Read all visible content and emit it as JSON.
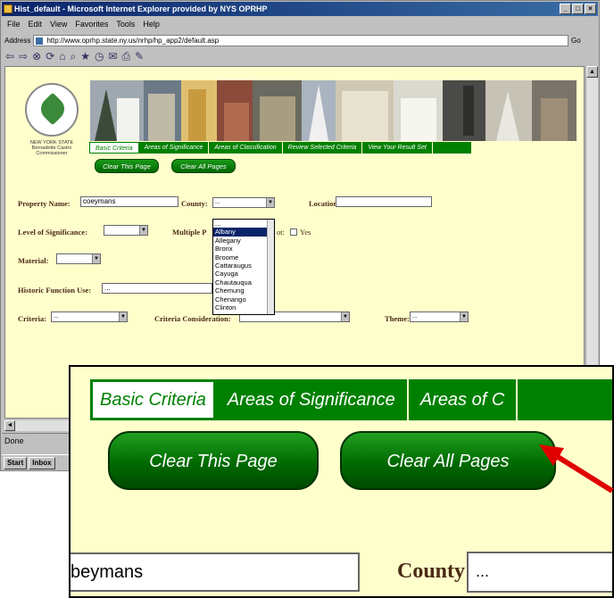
{
  "window": {
    "title": "Hist_default - Microsoft Internet Explorer provided by NYS OPRHP",
    "menu": [
      "File",
      "Edit",
      "View",
      "Favorites",
      "Tools",
      "Help"
    ],
    "address_label": "Address",
    "address": "http://www.oprhp.state.ny.us/nrhp/hp_app2/default.asp",
    "go_label": "Go",
    "status": "Done",
    "taskbar": [
      "Start",
      "Inbox"
    ]
  },
  "header": {
    "seal_caption": "NEW YORK STATE Bernadette Castro Commissioner"
  },
  "nav": {
    "tabs": [
      "Basic Criteria",
      "Areas of Significance",
      "Areas of Classification",
      "Review Selected Criteria",
      "View Your Result Set"
    ],
    "active_index": 0,
    "clear_page": "Clear This Page",
    "clear_all": "Clear All Pages"
  },
  "form": {
    "property_name_label": "Property Name:",
    "property_name_value": "coeymans",
    "county_label": "County:",
    "county_value": "...",
    "location_label": "Location:",
    "level_label": "Level of Significance:",
    "multiple_label": "Multiple P",
    "ot_label": "ot:",
    "yes_label": "Yes",
    "material_label": "Material:",
    "historic_function_label": "Historic Function Use:",
    "historic_function_value": "...",
    "criteria_label": "Criteria:",
    "criteria_value": "...",
    "criteria_considerations_label": "Criteria Consideration:",
    "theme_label": "Theme:",
    "theme_value": "..."
  },
  "county_dropdown": {
    "options": [
      "...",
      "Albany",
      "Allegany",
      "Bronx",
      "Broome",
      "Cattaraugus",
      "Cayuga",
      "Chautauqua",
      "Chemung",
      "Chenango",
      "Clinton"
    ],
    "selected": "Albany"
  },
  "zoom": {
    "tabs": [
      "Basic Criteria",
      "Areas of Significance",
      "Areas of C"
    ],
    "clear_page": "Clear This Page",
    "clear_all": "Clear All Pages",
    "property_value": "beymans",
    "county_label": "County:",
    "county_value": "..."
  },
  "colors": {
    "page_bg": "#ffffcc",
    "nav_green": "#008000",
    "label_brown": "#4b2a14",
    "arrow_red": "#e00000"
  }
}
